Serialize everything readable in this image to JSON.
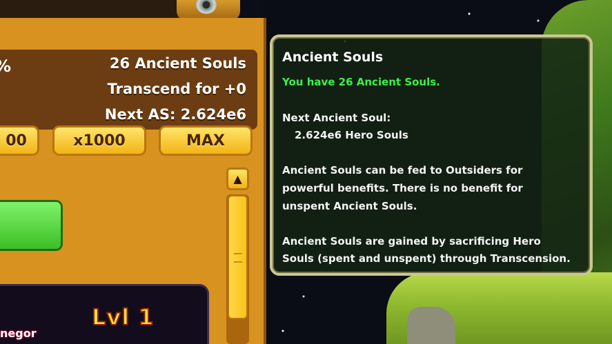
{
  "stats": {
    "ancient_souls_line": "26 Ancient Souls",
    "transcend_line": "Transcend for +0",
    "next_as_line": "Next AS:  2.624e6",
    "percent_fragment": "%"
  },
  "buy_buttons": {
    "partial_label": "00",
    "x1000_label": "x1000",
    "max_label": "MAX"
  },
  "scroll": {
    "up_arrow": "▲"
  },
  "hero": {
    "level_label": "Lvl 1",
    "name_fragment": "negor"
  },
  "tooltip": {
    "title": "Ancient Souls",
    "have_line": "You have 26 Ancient Souls.",
    "next_label": "Next Ancient Soul:",
    "next_value": "2.624e6 Hero Souls",
    "desc1_l1": "Ancient Souls can be fed to Outsiders for",
    "desc1_l2": "powerful benefits. There is no benefit for",
    "desc1_l3": "unspent Ancient Souls.",
    "desc2_l1": "Ancient Souls are gained by sacrificing Hero",
    "desc2_l2": "Souls (spent and unspent) through Transcension."
  },
  "colors": {
    "panel": "#d8921f",
    "stats_bg": "#6c3d12",
    "tooltip_green": "#3cf049",
    "tooltip_border": "#c9c892"
  }
}
